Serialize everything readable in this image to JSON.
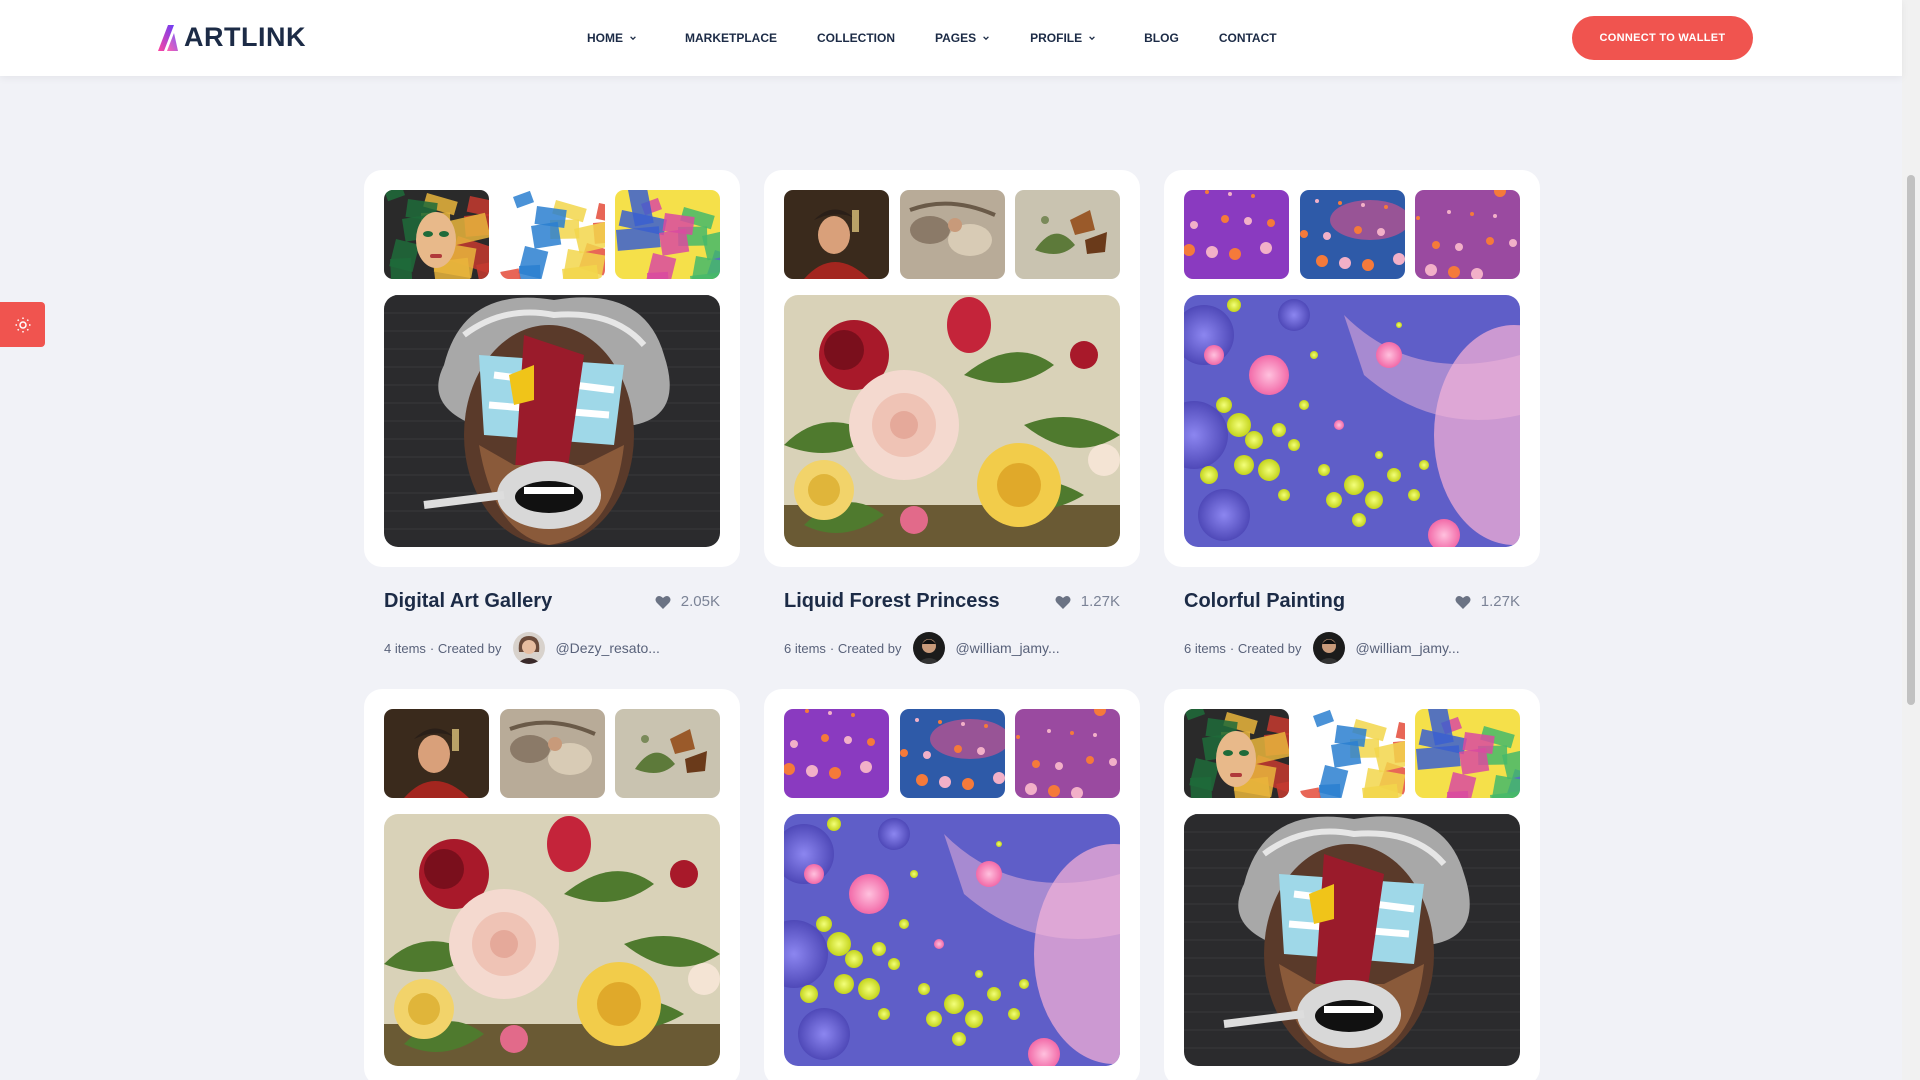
{
  "brand": {
    "name": "ARTLINK",
    "gradient": [
      "#ff45a0",
      "#6b3df5"
    ]
  },
  "nav": [
    {
      "label": "HOME",
      "dropdown": true
    },
    {
      "label": "MARKETPLACE",
      "dropdown": false
    },
    {
      "label": "COLLECTION",
      "dropdown": false
    },
    {
      "label": "PAGES",
      "dropdown": true
    },
    {
      "label": "PROFILE",
      "dropdown": true
    },
    {
      "label": "BLOG",
      "dropdown": false
    },
    {
      "label": "CONTACT",
      "dropdown": false
    }
  ],
  "header": {
    "cta_label": "CONNECT TO WALLET"
  },
  "accent_color": "#f0544f",
  "cards": [
    {
      "title": "Digital Art Gallery",
      "likes": "2.05K",
      "items": "4 items",
      "created_by": "· Created by",
      "handle": "@Dezy_resato...",
      "art": "street",
      "avatar": "woman"
    },
    {
      "title": "Liquid Forest Princess",
      "likes": "1.27K",
      "items": "6 items",
      "created_by": "· Created by",
      "handle": "@william_jamy...",
      "art": "classic",
      "avatar": "man"
    },
    {
      "title": "Colorful Painting",
      "likes": "1.27K",
      "items": "6 items",
      "created_by": "· Created by",
      "handle": "@william_jamy...",
      "art": "bubbles",
      "avatar": "man"
    },
    {
      "title": "",
      "likes": "",
      "items": "",
      "created_by": "",
      "handle": "",
      "art": "classic",
      "avatar": ""
    },
    {
      "title": "",
      "likes": "",
      "items": "",
      "created_by": "",
      "handle": "",
      "art": "bubbles",
      "avatar": ""
    },
    {
      "title": "",
      "likes": "",
      "items": "",
      "created_by": "",
      "handle": "",
      "art": "street",
      "avatar": ""
    }
  ]
}
